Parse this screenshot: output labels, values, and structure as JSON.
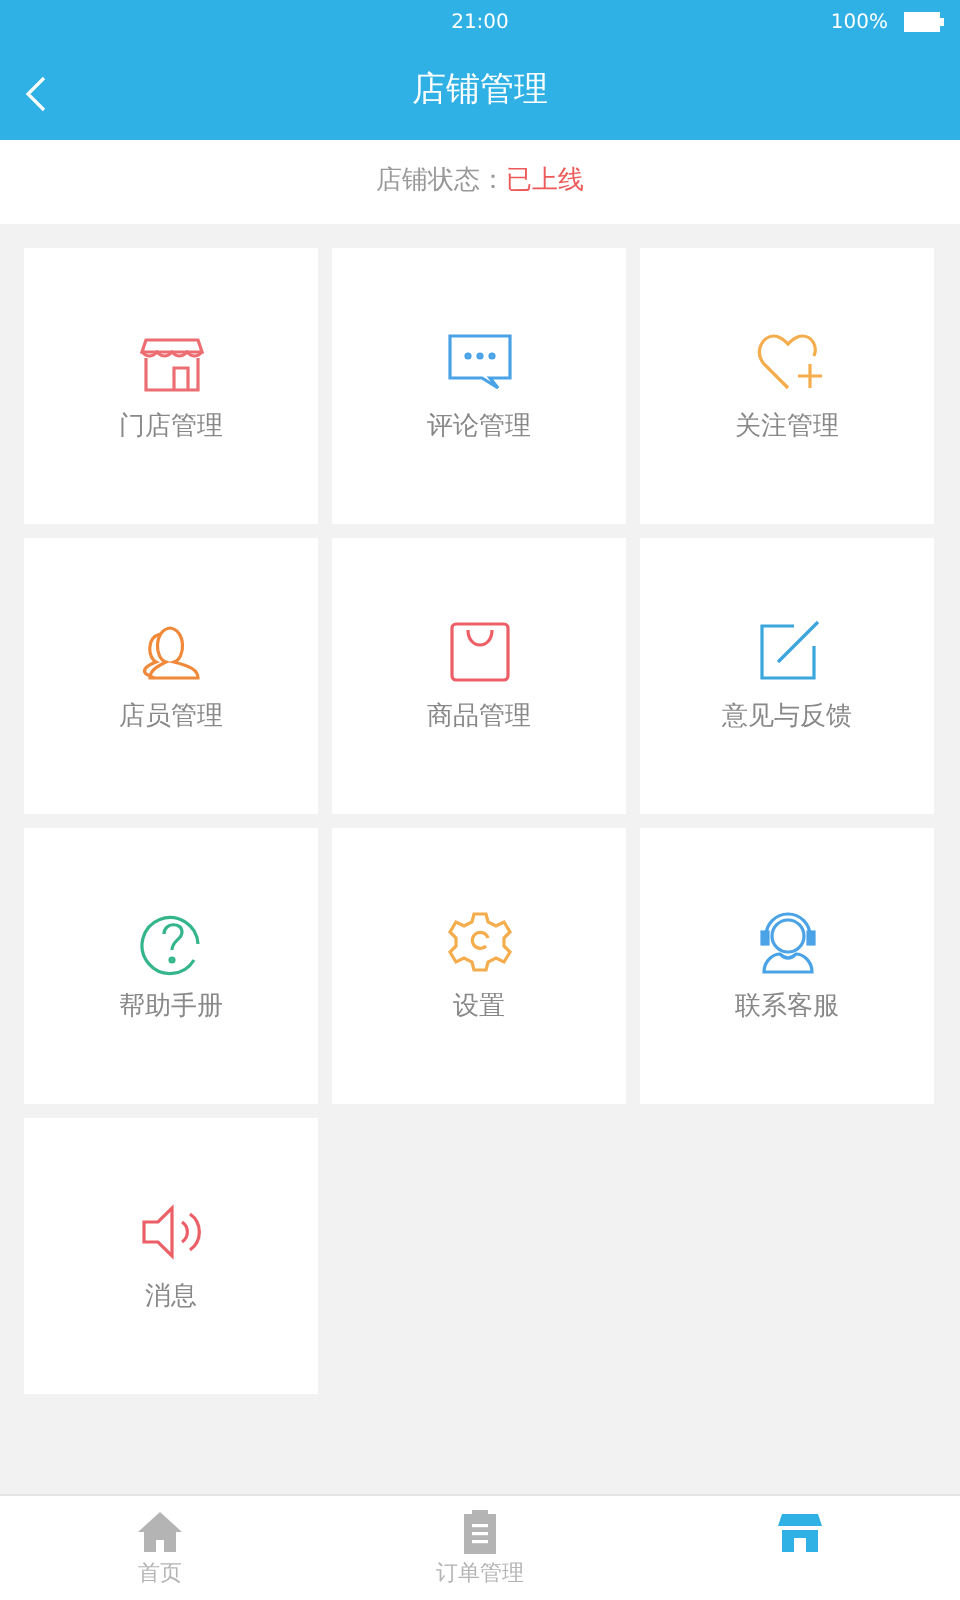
{
  "status_bar": {
    "time": "21:00",
    "battery": "100%"
  },
  "header": {
    "title": "店铺管理"
  },
  "store_status": {
    "label": "店铺状态：",
    "value": "已上线"
  },
  "tiles": [
    {
      "label": "门店管理",
      "color": "#ec6e72"
    },
    {
      "label": "评论管理",
      "color": "#4aa3e6"
    },
    {
      "label": "关注管理",
      "color": "#f4ac4c"
    },
    {
      "label": "店员管理",
      "color": "#f08a3a"
    },
    {
      "label": "商品管理",
      "color": "#ec5f66"
    },
    {
      "label": "意见与反馈",
      "color": "#3ba6dc"
    },
    {
      "label": "帮助手册",
      "color": "#35b58c"
    },
    {
      "label": "设置",
      "color": "#f4ac4c"
    },
    {
      "label": "联系客服",
      "color": "#4aa3e6"
    },
    {
      "label": "消息",
      "color": "#ec5f66"
    }
  ],
  "tab_bar": [
    {
      "label": "首页",
      "selected": false
    },
    {
      "label": "订单管理",
      "selected": false
    },
    {
      "selected": true
    }
  ]
}
